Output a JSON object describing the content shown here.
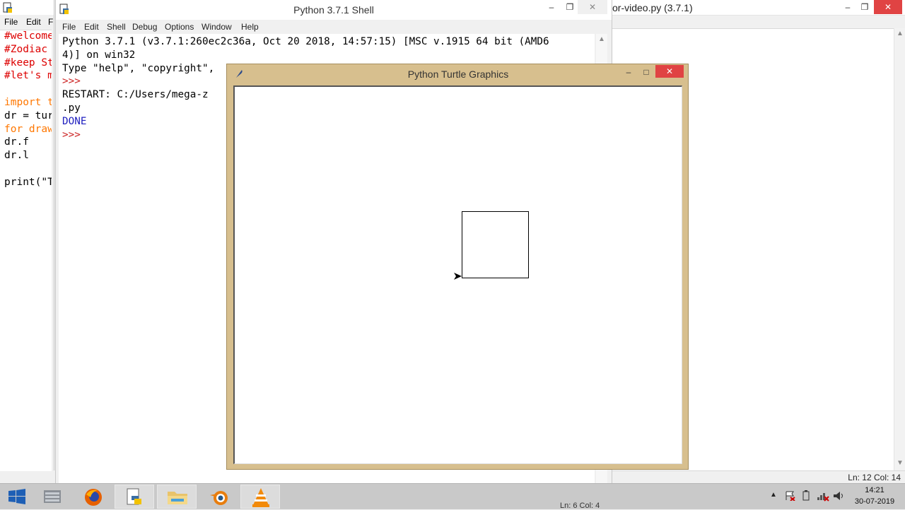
{
  "editor": {
    "title": "or-video.py (3.7.1)",
    "status": "Ln: 12   Col: 14"
  },
  "left_editor": {
    "menu": [
      "File",
      "Edit",
      "F"
    ],
    "code": [
      {
        "text": "#welcome",
        "kind": "comment"
      },
      {
        "text": "#Zodiac",
        "kind": "comment"
      },
      {
        "text": "#keep St",
        "kind": "comment"
      },
      {
        "text": "#let's m",
        "kind": "comment"
      },
      {
        "text": "",
        "kind": "plain"
      },
      {
        "text": "import t",
        "kind": "kw"
      },
      {
        "text": "dr = tur",
        "kind": "plain"
      },
      {
        "text": "for draw",
        "kind": "kw"
      },
      {
        "text": "    dr.f",
        "kind": "plain"
      },
      {
        "text": "    dr.l",
        "kind": "plain"
      },
      {
        "text": "",
        "kind": "plain"
      },
      {
        "text": "print(\"T",
        "kind": "plain"
      }
    ]
  },
  "shell": {
    "title": "Python 3.7.1 Shell",
    "menu": [
      "File",
      "Edit",
      "Shell",
      "Debug",
      "Options",
      "Window",
      "Help"
    ],
    "lines": [
      {
        "text": "Python 3.7.1 (v3.7.1:260ec2c36a, Oct 20 2018, 14:57:15) [MSC v.1915 64 bit (AMD6",
        "kind": "plain"
      },
      {
        "text": "4)] on win32",
        "kind": "plain"
      },
      {
        "text": "Type \"help\", \"copyright\",",
        "kind": "plain"
      },
      {
        "text": ">>>",
        "kind": "prompt"
      },
      {
        "text": " RESTART: C:/Users/mega-z",
        "kind": "plain"
      },
      {
        "text": ".py",
        "kind": "plain"
      },
      {
        "text": "DONE",
        "kind": "output"
      },
      {
        "text": ">>>",
        "kind": "prompt"
      }
    ],
    "status": "Ln: 6   Col: 4"
  },
  "turtle": {
    "title": "Python Turtle Graphics"
  },
  "taskbar": {
    "apps": [
      "start-menu",
      "server-manager",
      "firefox",
      "python-idle",
      "file-explorer",
      "blender",
      "vlc"
    ],
    "time": "14:21",
    "date": "30-07-2019"
  },
  "window_buttons": {
    "minimize": "–",
    "maximize": "□",
    "close": "✕"
  }
}
